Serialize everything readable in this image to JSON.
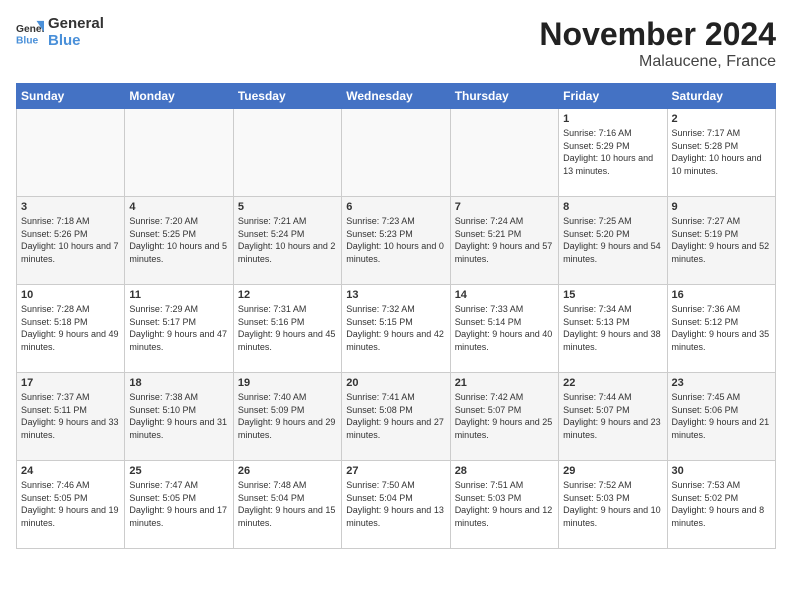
{
  "header": {
    "logo_line1": "General",
    "logo_line2": "Blue",
    "month_year": "November 2024",
    "location": "Malaucene, France"
  },
  "days_of_week": [
    "Sunday",
    "Monday",
    "Tuesday",
    "Wednesday",
    "Thursday",
    "Friday",
    "Saturday"
  ],
  "weeks": [
    [
      {
        "day": "",
        "info": ""
      },
      {
        "day": "",
        "info": ""
      },
      {
        "day": "",
        "info": ""
      },
      {
        "day": "",
        "info": ""
      },
      {
        "day": "",
        "info": ""
      },
      {
        "day": "1",
        "info": "Sunrise: 7:16 AM\nSunset: 5:29 PM\nDaylight: 10 hours and 13 minutes."
      },
      {
        "day": "2",
        "info": "Sunrise: 7:17 AM\nSunset: 5:28 PM\nDaylight: 10 hours and 10 minutes."
      }
    ],
    [
      {
        "day": "3",
        "info": "Sunrise: 7:18 AM\nSunset: 5:26 PM\nDaylight: 10 hours and 7 minutes."
      },
      {
        "day": "4",
        "info": "Sunrise: 7:20 AM\nSunset: 5:25 PM\nDaylight: 10 hours and 5 minutes."
      },
      {
        "day": "5",
        "info": "Sunrise: 7:21 AM\nSunset: 5:24 PM\nDaylight: 10 hours and 2 minutes."
      },
      {
        "day": "6",
        "info": "Sunrise: 7:23 AM\nSunset: 5:23 PM\nDaylight: 10 hours and 0 minutes."
      },
      {
        "day": "7",
        "info": "Sunrise: 7:24 AM\nSunset: 5:21 PM\nDaylight: 9 hours and 57 minutes."
      },
      {
        "day": "8",
        "info": "Sunrise: 7:25 AM\nSunset: 5:20 PM\nDaylight: 9 hours and 54 minutes."
      },
      {
        "day": "9",
        "info": "Sunrise: 7:27 AM\nSunset: 5:19 PM\nDaylight: 9 hours and 52 minutes."
      }
    ],
    [
      {
        "day": "10",
        "info": "Sunrise: 7:28 AM\nSunset: 5:18 PM\nDaylight: 9 hours and 49 minutes."
      },
      {
        "day": "11",
        "info": "Sunrise: 7:29 AM\nSunset: 5:17 PM\nDaylight: 9 hours and 47 minutes."
      },
      {
        "day": "12",
        "info": "Sunrise: 7:31 AM\nSunset: 5:16 PM\nDaylight: 9 hours and 45 minutes."
      },
      {
        "day": "13",
        "info": "Sunrise: 7:32 AM\nSunset: 5:15 PM\nDaylight: 9 hours and 42 minutes."
      },
      {
        "day": "14",
        "info": "Sunrise: 7:33 AM\nSunset: 5:14 PM\nDaylight: 9 hours and 40 minutes."
      },
      {
        "day": "15",
        "info": "Sunrise: 7:34 AM\nSunset: 5:13 PM\nDaylight: 9 hours and 38 minutes."
      },
      {
        "day": "16",
        "info": "Sunrise: 7:36 AM\nSunset: 5:12 PM\nDaylight: 9 hours and 35 minutes."
      }
    ],
    [
      {
        "day": "17",
        "info": "Sunrise: 7:37 AM\nSunset: 5:11 PM\nDaylight: 9 hours and 33 minutes."
      },
      {
        "day": "18",
        "info": "Sunrise: 7:38 AM\nSunset: 5:10 PM\nDaylight: 9 hours and 31 minutes."
      },
      {
        "day": "19",
        "info": "Sunrise: 7:40 AM\nSunset: 5:09 PM\nDaylight: 9 hours and 29 minutes."
      },
      {
        "day": "20",
        "info": "Sunrise: 7:41 AM\nSunset: 5:08 PM\nDaylight: 9 hours and 27 minutes."
      },
      {
        "day": "21",
        "info": "Sunrise: 7:42 AM\nSunset: 5:07 PM\nDaylight: 9 hours and 25 minutes."
      },
      {
        "day": "22",
        "info": "Sunrise: 7:44 AM\nSunset: 5:07 PM\nDaylight: 9 hours and 23 minutes."
      },
      {
        "day": "23",
        "info": "Sunrise: 7:45 AM\nSunset: 5:06 PM\nDaylight: 9 hours and 21 minutes."
      }
    ],
    [
      {
        "day": "24",
        "info": "Sunrise: 7:46 AM\nSunset: 5:05 PM\nDaylight: 9 hours and 19 minutes."
      },
      {
        "day": "25",
        "info": "Sunrise: 7:47 AM\nSunset: 5:05 PM\nDaylight: 9 hours and 17 minutes."
      },
      {
        "day": "26",
        "info": "Sunrise: 7:48 AM\nSunset: 5:04 PM\nDaylight: 9 hours and 15 minutes."
      },
      {
        "day": "27",
        "info": "Sunrise: 7:50 AM\nSunset: 5:04 PM\nDaylight: 9 hours and 13 minutes."
      },
      {
        "day": "28",
        "info": "Sunrise: 7:51 AM\nSunset: 5:03 PM\nDaylight: 9 hours and 12 minutes."
      },
      {
        "day": "29",
        "info": "Sunrise: 7:52 AM\nSunset: 5:03 PM\nDaylight: 9 hours and 10 minutes."
      },
      {
        "day": "30",
        "info": "Sunrise: 7:53 AM\nSunset: 5:02 PM\nDaylight: 9 hours and 8 minutes."
      }
    ]
  ]
}
